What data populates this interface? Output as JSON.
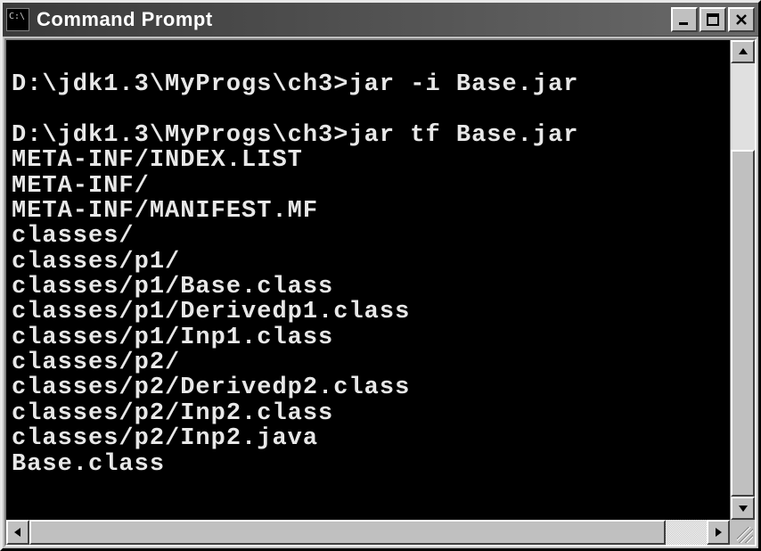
{
  "window": {
    "title": "Command Prompt"
  },
  "console": {
    "lines": [
      "",
      "D:\\jdk1.3\\MyProgs\\ch3>jar -i Base.jar",
      "",
      "D:\\jdk1.3\\MyProgs\\ch3>jar tf Base.jar",
      "META-INF/INDEX.LIST",
      "META-INF/",
      "META-INF/MANIFEST.MF",
      "classes/",
      "classes/p1/",
      "classes/p1/Base.class",
      "classes/p1/Derivedp1.class",
      "classes/p1/Inp1.class",
      "classes/p2/",
      "classes/p2/Derivedp2.class",
      "classes/p2/Inp2.class",
      "classes/p2/Inp2.java",
      "Base.class"
    ]
  }
}
